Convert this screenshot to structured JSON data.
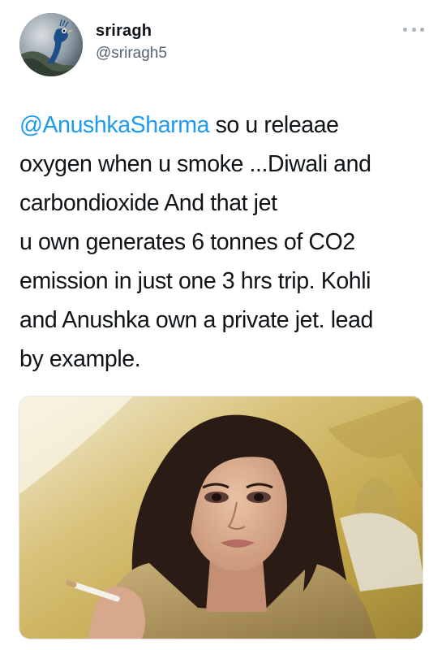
{
  "user": {
    "display_name": "sriragh",
    "handle": "@sriragh5"
  },
  "tweet": {
    "mention": "@AnushkaSharma",
    "line1_rest": " so u releaae",
    "line2": "oxygen when u smoke ...Diwali and",
    "line3": "carbondioxide And that jet",
    "line4": "u own generates  6 tonnes of CO2",
    "line5": "emission in just one 3 hrs trip. Kohli",
    "line6": "and Anushka own a private jet. lead",
    "line7": "by example."
  },
  "icons": {
    "more": "more-horizontal-icon",
    "avatar": "peacock-avatar"
  },
  "colors": {
    "link": "#1d9bf0",
    "text": "#0f1419",
    "secondary": "#536471"
  }
}
